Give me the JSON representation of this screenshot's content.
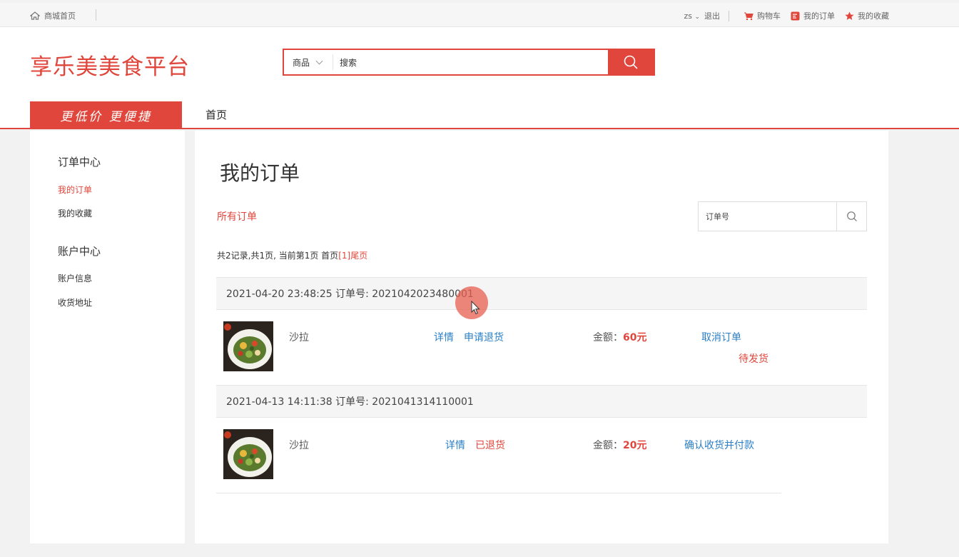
{
  "topbar": {
    "home_icon": "home-icon",
    "home_label": "商城首页",
    "user": "zs",
    "logout": "退出",
    "cart": "购物车",
    "my_orders": "我的订单",
    "favorites": "我的收藏",
    "accent": "#e0463b"
  },
  "header": {
    "logo": "享乐美美食平台",
    "search_category": "商品",
    "search_value": "搜索",
    "slogan": "更低价 更便捷",
    "nav_home": "首页"
  },
  "sidebar": {
    "order_center": "订单中心",
    "order_items": [
      {
        "label": "我的订单",
        "active": true
      },
      {
        "label": "我的收藏",
        "active": false
      }
    ],
    "account_center": "账户中心",
    "account_items": [
      {
        "label": "账户信息"
      },
      {
        "label": "收货地址"
      }
    ]
  },
  "main": {
    "title": "我的订单",
    "all_orders": "所有订单",
    "order_search_placeholder": "订单号",
    "pager": {
      "summary": "共2记录,共1页, 当前第1页 ",
      "first": "首页",
      "current": "[1]",
      "last": "尾页"
    },
    "orders": [
      {
        "header": "2021-04-20 23:48:25 订单号: 2021042023480001",
        "item_name": "沙拉",
        "detail": "详情",
        "second_action": "申请退货",
        "amount_label": "金额：",
        "amount": "60元",
        "main_action": "取消订单",
        "status": "待发货"
      },
      {
        "header": "2021-04-13 14:11:38 订单号: 2021041314110001",
        "item_name": "沙拉",
        "detail": "详情",
        "second_action": "已退货",
        "amount_label": "金额：",
        "amount": "20元",
        "main_action": "确认收货并付款",
        "status": ""
      }
    ]
  }
}
